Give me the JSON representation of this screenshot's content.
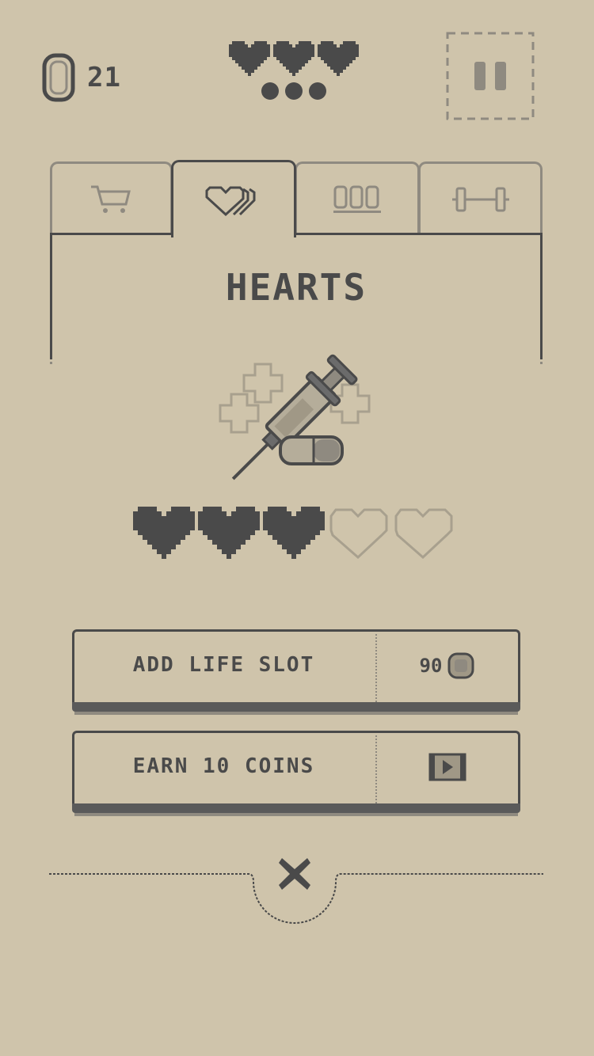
{
  "hud": {
    "coins": "21",
    "lives_filled": 3,
    "extra_dots": 3
  },
  "tabs": [
    {
      "icon": "cart-icon",
      "active": false
    },
    {
      "icon": "hearts-icon",
      "active": true
    },
    {
      "icon": "coin-stack-icon",
      "active": false
    },
    {
      "icon": "dumbbell-icon",
      "active": false
    }
  ],
  "panel": {
    "title": "HEARTS",
    "item_icon": "syringe-pill-icon"
  },
  "life_slots": {
    "filled": 3,
    "total": 5
  },
  "actions": {
    "add_life_slot": {
      "label": "ADD LIFE SLOT",
      "price": "90"
    },
    "earn_coins": {
      "label": "EARN 10 COINS",
      "icon": "video-play-icon"
    }
  },
  "colors": {
    "background": "#cfc4ab",
    "ink": "#4a4a4a",
    "muted": "#8f8a80"
  }
}
